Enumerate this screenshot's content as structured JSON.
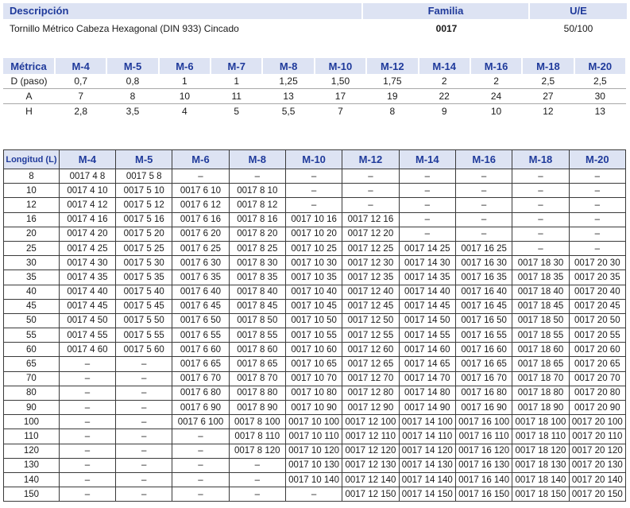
{
  "header": {
    "descripcion": "Descripción",
    "familia": "Familia",
    "ue": "U/E"
  },
  "product": {
    "description": "Tornillo Métrico Cabeza Hexagonal  (DIN 933) Cincado",
    "familia": "0017",
    "ue": "50/100"
  },
  "metric_table": {
    "corner": "Métrica",
    "columns": [
      "M-4",
      "M-5",
      "M-6",
      "M-7",
      "M-8",
      "M-10",
      "M-12",
      "M-14",
      "M-16",
      "M-18",
      "M-20"
    ],
    "rows": [
      {
        "label": "D (paso)",
        "values": [
          "0,7",
          "0,8",
          "1",
          "1",
          "1,25",
          "1,50",
          "1,75",
          "2",
          "2",
          "2,5",
          "2,5"
        ]
      },
      {
        "label": "A",
        "values": [
          "7",
          "8",
          "10",
          "11",
          "13",
          "17",
          "19",
          "22",
          "24",
          "27",
          "30"
        ]
      },
      {
        "label": "H",
        "values": [
          "2,8",
          "3,5",
          "4",
          "5",
          "5,5",
          "7",
          "8",
          "9",
          "10",
          "12",
          "13"
        ]
      }
    ]
  },
  "size_table": {
    "corner": "Longitud (L)",
    "columns": [
      "M-4",
      "M-5",
      "M-6",
      "M-8",
      "M-10",
      "M-12",
      "M-14",
      "M-16",
      "M-18",
      "M-20"
    ],
    "rows": [
      {
        "length": "8",
        "codes": [
          "0017 4 8",
          "0017 5 8",
          "–",
          "–",
          "–",
          "–",
          "–",
          "–",
          "–",
          "–"
        ]
      },
      {
        "length": "10",
        "codes": [
          "0017 4 10",
          "0017 5 10",
          "0017 6 10",
          "0017 8 10",
          "–",
          "–",
          "–",
          "–",
          "–",
          "–"
        ]
      },
      {
        "length": "12",
        "codes": [
          "0017 4 12",
          "0017 5 12",
          "0017 6 12",
          "0017 8 12",
          "–",
          "–",
          "–",
          "–",
          "–",
          "–"
        ]
      },
      {
        "length": "16",
        "codes": [
          "0017 4 16",
          "0017 5 16",
          "0017 6 16",
          "0017 8 16",
          "0017 10 16",
          "0017 12 16",
          "–",
          "–",
          "–",
          "–"
        ]
      },
      {
        "length": "20",
        "codes": [
          "0017 4 20",
          "0017 5 20",
          "0017 6 20",
          "0017 8 20",
          "0017 10 20",
          "0017 12 20",
          "–",
          "–",
          "–",
          "–"
        ]
      },
      {
        "length": "25",
        "codes": [
          "0017 4 25",
          "0017 5 25",
          "0017 6 25",
          "0017 8 25",
          "0017 10 25",
          "0017 12 25",
          "0017 14 25",
          "0017 16 25",
          "–",
          "–"
        ]
      },
      {
        "length": "30",
        "codes": [
          "0017 4 30",
          "0017 5 30",
          "0017 6 30",
          "0017 8 30",
          "0017 10 30",
          "0017 12 30",
          "0017 14 30",
          "0017 16 30",
          "0017 18 30",
          "0017 20 30"
        ]
      },
      {
        "length": "35",
        "codes": [
          "0017 4 35",
          "0017 5 35",
          "0017 6 35",
          "0017 8 35",
          "0017 10 35",
          "0017 12 35",
          "0017 14 35",
          "0017 16 35",
          "0017 18 35",
          "0017 20 35"
        ]
      },
      {
        "length": "40",
        "codes": [
          "0017 4 40",
          "0017 5 40",
          "0017 6 40",
          "0017 8 40",
          "0017 10 40",
          "0017 12 40",
          "0017 14 40",
          "0017 16 40",
          "0017 18 40",
          "0017 20 40"
        ]
      },
      {
        "length": "45",
        "codes": [
          "0017 4 45",
          "0017 5 45",
          "0017 6 45",
          "0017 8 45",
          "0017 10 45",
          "0017 12 45",
          "0017 14 45",
          "0017 16 45",
          "0017 18 45",
          "0017 20 45"
        ]
      },
      {
        "length": "50",
        "codes": [
          "0017 4 50",
          "0017 5 50",
          "0017 6 50",
          "0017 8 50",
          "0017 10 50",
          "0017 12 50",
          "0017 14 50",
          "0017 16 50",
          "0017 18 50",
          "0017 20 50"
        ]
      },
      {
        "length": "55",
        "codes": [
          "0017 4 55",
          "0017 5 55",
          "0017 6 55",
          "0017 8 55",
          "0017 10 55",
          "0017 12 55",
          "0017 14 55",
          "0017 16 55",
          "0017 18 55",
          "0017 20 55"
        ]
      },
      {
        "length": "60",
        "codes": [
          "0017 4 60",
          "0017 5 60",
          "0017 6 60",
          "0017 8 60",
          "0017 10 60",
          "0017 12 60",
          "0017 14 60",
          "0017 16 60",
          "0017 18 60",
          "0017 20 60"
        ]
      },
      {
        "length": "65",
        "codes": [
          "–",
          "–",
          "0017 6 65",
          "0017 8 65",
          "0017 10 65",
          "0017 12 65",
          "0017 14 65",
          "0017 16 65",
          "0017 18 65",
          "0017 20 65"
        ]
      },
      {
        "length": "70",
        "codes": [
          "–",
          "–",
          "0017 6 70",
          "0017 8 70",
          "0017 10 70",
          "0017 12 70",
          "0017 14 70",
          "0017 16 70",
          "0017 18 70",
          "0017 20 70"
        ]
      },
      {
        "length": "80",
        "codes": [
          "–",
          "–",
          "0017 6 80",
          "0017 8 80",
          "0017 10 80",
          "0017 12 80",
          "0017 14 80",
          "0017 16 80",
          "0017 18 80",
          "0017 20 80"
        ]
      },
      {
        "length": "90",
        "codes": [
          "–",
          "–",
          "0017 6 90",
          "0017 8 90",
          "0017 10 90",
          "0017 12 90",
          "0017 14 90",
          "0017 16 90",
          "0017 18 90",
          "0017 20 90"
        ]
      },
      {
        "length": "100",
        "codes": [
          "–",
          "–",
          "0017 6 100",
          "0017 8 100",
          "0017 10 100",
          "0017 12 100",
          "0017 14 100",
          "0017 16 100",
          "0017 18 100",
          "0017 20 100"
        ]
      },
      {
        "length": "110",
        "codes": [
          "–",
          "–",
          "–",
          "0017 8 110",
          "0017 10 110",
          "0017 12 110",
          "0017 14 110",
          "0017 16 110",
          "0017 18 110",
          "0017 20 110"
        ]
      },
      {
        "length": "120",
        "codes": [
          "–",
          "–",
          "–",
          "0017 8 120",
          "0017 10 120",
          "0017 12 120",
          "0017 14 120",
          "0017 16 120",
          "0017 18 120",
          "0017 20 120"
        ]
      },
      {
        "length": "130",
        "codes": [
          "–",
          "–",
          "–",
          "–",
          "0017 10 130",
          "0017 12 130",
          "0017 14 130",
          "0017 16 130",
          "0017 18 130",
          "0017 20 130"
        ]
      },
      {
        "length": "140",
        "codes": [
          "–",
          "–",
          "–",
          "–",
          "0017 10 140",
          "0017 12 140",
          "0017 14 140",
          "0017 16 140",
          "0017 18 140",
          "0017 20 140"
        ]
      },
      {
        "length": "150",
        "codes": [
          "–",
          "–",
          "–",
          "–",
          "–",
          "0017 12 150",
          "0017 14 150",
          "0017 16 150",
          "0017 18 150",
          "0017 20 150"
        ]
      }
    ]
  }
}
